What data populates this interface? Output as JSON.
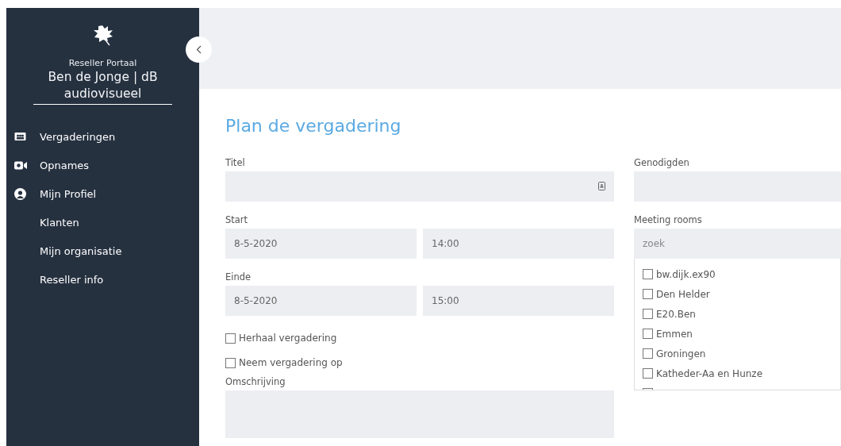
{
  "sidebar": {
    "portal": "Reseller Portaal",
    "account": "Ben de Jonge | dB audiovisueel",
    "items": [
      {
        "label": "Vergaderingen",
        "kind": "meeting"
      },
      {
        "label": "Opnames",
        "kind": "camera"
      },
      {
        "label": "Mijn Profiel",
        "kind": "profile"
      },
      {
        "label": "Klanten",
        "kind": "plain"
      },
      {
        "label": "Mijn organisatie",
        "kind": "plain"
      },
      {
        "label": "Reseller info",
        "kind": "plain"
      }
    ]
  },
  "form": {
    "title": "Plan de vergadering",
    "titel": {
      "label": "Titel"
    },
    "start": {
      "label": "Start",
      "date": "8-5-2020",
      "time": "14:00"
    },
    "einde": {
      "label": "Einde",
      "date": "8-5-2020",
      "time": "15:00"
    },
    "options": [
      {
        "label": "Herhaal vergadering",
        "checked": false
      },
      {
        "label": "Neem vergadering op",
        "checked": false
      }
    ],
    "omschrijving": {
      "label": "Omschrijving"
    },
    "genodigden": {
      "label": "Genodigden"
    },
    "rooms": {
      "label": "Meeting rooms",
      "placeholder": "zoek",
      "items": [
        {
          "label": "bw.dijk.ex90",
          "checked": false
        },
        {
          "label": "Den Helder",
          "checked": false
        },
        {
          "label": "E20.Ben",
          "checked": false
        },
        {
          "label": "Emmen",
          "checked": false
        },
        {
          "label": "Groningen",
          "checked": false
        },
        {
          "label": "Katheder-Aa en Hunze",
          "checked": false
        }
      ]
    }
  }
}
